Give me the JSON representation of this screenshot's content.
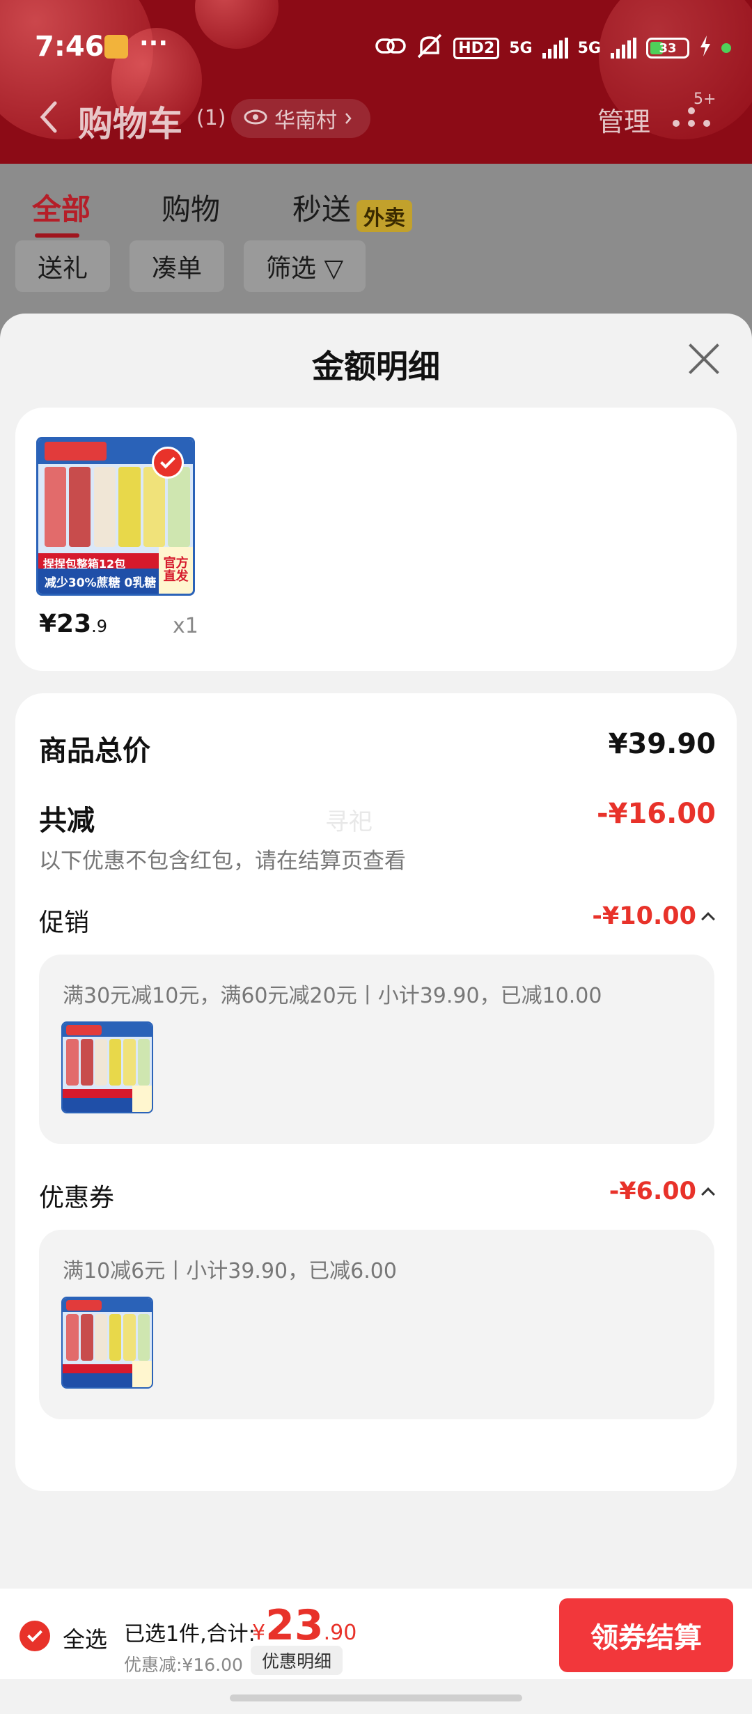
{
  "status_bar": {
    "time": "7:46",
    "more": "···",
    "hd_label": "HD2",
    "network_1": "5G",
    "network_2": "5G",
    "battery": "33"
  },
  "nav": {
    "title": "购物车",
    "count": "(1)",
    "location": "华南村",
    "manage": "管理",
    "more_badge": "5+"
  },
  "tabs": [
    {
      "label": "全部"
    },
    {
      "label": "购物"
    },
    {
      "label": "秒送"
    }
  ],
  "takeout_badge": "外卖",
  "chips": [
    {
      "label": "送礼"
    },
    {
      "label": "凑单"
    },
    {
      "label": "筛选 ▽"
    }
  ],
  "sheet": {
    "title": "金额明细",
    "product": {
      "price_int": "¥23",
      "price_dec": ".9",
      "qty": "x1",
      "image_band_red": "捏捏包整箱12包",
      "image_band_blue": "减少30%蔗糖 0乳糖",
      "image_official_1": "官方",
      "image_official_2": "直发"
    },
    "total_label": "商品总价",
    "total_value": "¥39.90",
    "reduce_label": "共减",
    "reduce_value": "-¥16.00",
    "reduce_note": "以下优惠不包含红包，请在结算页查看",
    "watermark": "寻祀",
    "promotion": {
      "label": "促销",
      "value": "-¥10.00",
      "detail": "满30元减10元，满60元减20元丨小计39.90，已减10.00"
    },
    "coupon": {
      "label": "优惠券",
      "value": "-¥6.00",
      "detail": "满10减6元丨小计39.90，已减6.00"
    }
  },
  "bottom_bar": {
    "select_all": "全选",
    "summary": "已选1件,合计:",
    "currency": "¥",
    "total_int": "23",
    "total_dec": ".90",
    "discount": "优惠减:¥16.00",
    "detail_button": "优惠明细",
    "checkout": "领券结算"
  },
  "colors": {
    "header_red": "#8c0b16",
    "accent_red": "#e8322a",
    "checkout_red": "#f2373b"
  }
}
